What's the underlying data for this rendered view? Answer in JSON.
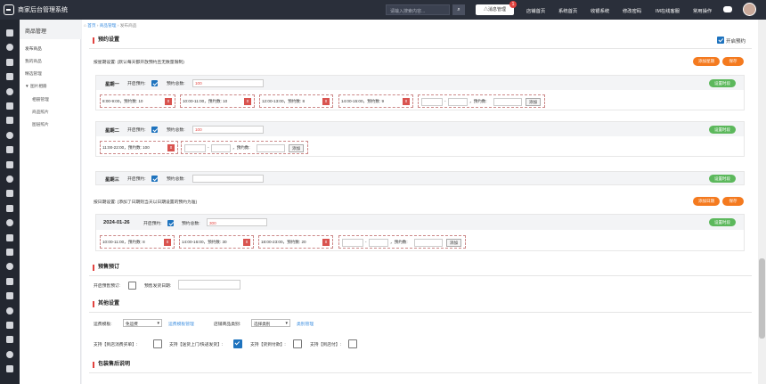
{
  "topbar": {
    "brand": "商家后台管理系统",
    "search_placeholder": "请输入搜索内容...",
    "search_icon": "search-icon",
    "message_label": "△消息管理",
    "message_count": "1",
    "nav": [
      "店铺首页",
      "系统首页",
      "收银系统",
      "修改密码",
      "IM在线客服",
      "常用操作"
    ]
  },
  "sidebar_icons": [
    "home-icon",
    "cloud-icon",
    "grid-icon",
    "cart-icon",
    "user-icon",
    "bank-icon",
    "plane-icon",
    "gift-icon",
    "globe-icon",
    "video-icon",
    "money-icon",
    "clock-icon",
    "users-icon",
    "star-icon",
    "trophy-icon",
    "share-icon",
    "tag-icon",
    "link-icon",
    "chat-icon",
    "megaphone-icon",
    "lock-icon",
    "doc-icon",
    "calc-icon",
    "cloud-upload-icon"
  ],
  "menu": {
    "header": "商品管理",
    "items": [
      "发布商品",
      "我的商品",
      "精选管理",
      "▼ 图片相册",
      "相册管理",
      "商品照片",
      "图层照片"
    ]
  },
  "breadcrumb": {
    "home": "首页",
    "sep1": "›",
    "level1": "商品管理",
    "sep2": "›",
    "level2": "发布商品"
  },
  "booking": {
    "title": "预约设置",
    "enable_label": "开启预约",
    "enabled": true,
    "weekly_label": "按星期设置: (默认每天都开放预约且无数量限制)",
    "btn_add_week": "添加星期",
    "btn_save": "保存",
    "btn_set_time": "设置时段",
    "open_label": "开启预约:",
    "total_label": "预约总数:",
    "amount_label": "，预约数:",
    "dash": "-",
    "add_label": "添加",
    "remove_symbol": "x",
    "days": [
      {
        "name": "星期一",
        "open": true,
        "total": "100",
        "slots": [
          "8:00-9:00，预约数: 10",
          "10:00-11:00，预约数: 10",
          "12:00-13:00，预约数: 8",
          "14:00-15:00，预约数: 9"
        ]
      },
      {
        "name": "星期二",
        "open": true,
        "total": "100",
        "slots": [
          "11:00-22:00，预约数: 100"
        ]
      },
      {
        "name": "星期三",
        "open": true,
        "total": "",
        "slots": []
      }
    ],
    "date_label": "按日期设置: (添加了日期则当天以日期设置的预约为准)",
    "btn_add_date": "添加日期",
    "date": {
      "name": "2024-01-26",
      "open": true,
      "total": "300",
      "slots": [
        "10:00-11:00，预约数: 8",
        "14:00-16:00，预约数: 30",
        "18:00-23:00，预约数: 20"
      ]
    }
  },
  "presale": {
    "title": "预售预订",
    "enable_label": "开启预售预订:",
    "enabled": false,
    "date_label": "预售发货日期:",
    "date_value": ""
  },
  "other": {
    "title": "其他设置",
    "shipping_label": "运费模板:",
    "shipping_value": "免运费",
    "shipping_link": "运费模板管理",
    "category_label": "店铺商品类别:",
    "category_value": "选择类别",
    "category_link": "类别管理",
    "opt1_label": "支持【到店消费买单】:",
    "opt1": false,
    "opt2_label": "支持【送货上门/快递发货】:",
    "opt2": true,
    "opt3_label": "支持【货到付款】:",
    "opt3": false,
    "opt4_label": "支持【到店付】:",
    "opt4": false
  },
  "aftersale": {
    "title": "包装售后说明"
  },
  "colors": {
    "topbar": "#2a2f3a",
    "sidebar": "#232730",
    "accent_red": "#e2433f",
    "orange": "#f47a1f",
    "green": "#5cb85c",
    "blue": "#1e73be"
  }
}
